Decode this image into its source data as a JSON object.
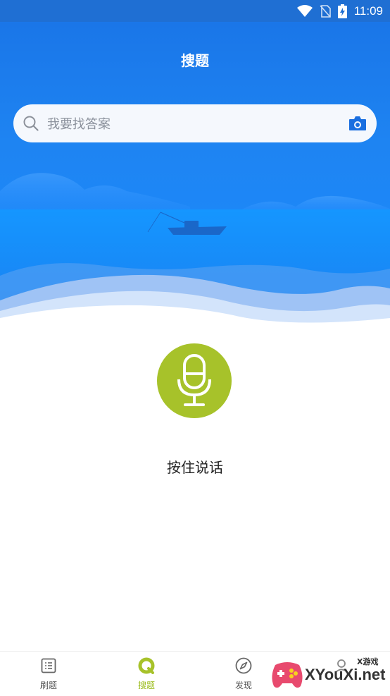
{
  "status_bar": {
    "time": "11:09"
  },
  "header": {
    "title": "搜题"
  },
  "search": {
    "placeholder": "我要找答案"
  },
  "voice": {
    "label": "按住说话"
  },
  "tabs": [
    {
      "label": "刷题",
      "icon": "list-icon",
      "active": false
    },
    {
      "label": "搜题",
      "icon": "search-tab-icon",
      "active": true
    },
    {
      "label": "发现",
      "icon": "compass-icon",
      "active": false
    }
  ],
  "watermark": {
    "text": "XYouXi.net",
    "small": "X游戏"
  },
  "colors": {
    "accent": "#a7c22a",
    "hero_blue": "#1b8cff",
    "status_blue": "#1f6fd3"
  }
}
